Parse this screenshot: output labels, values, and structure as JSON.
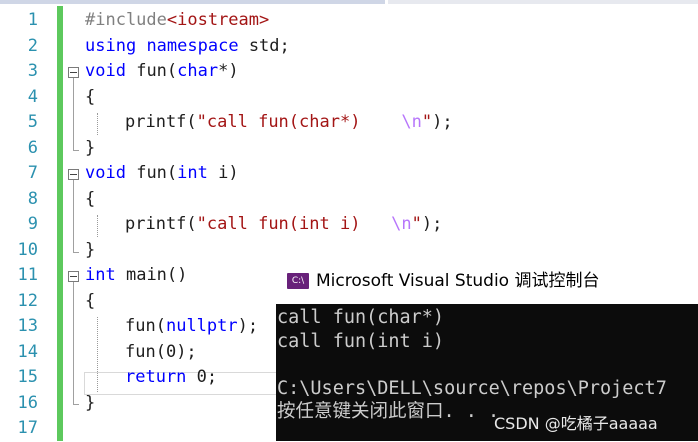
{
  "line_numbers": [
    "1",
    "2",
    "3",
    "4",
    "5",
    "6",
    "7",
    "8",
    "9",
    "10",
    "11",
    "12",
    "13",
    "14",
    "15",
    "16",
    "17"
  ],
  "code": {
    "l1": {
      "pp": "#include",
      "st": "<iostream>"
    },
    "l2": {
      "kw1": "using",
      "kw2": "namespace",
      "tx": "std;"
    },
    "l3": {
      "kw": "void",
      "fn": "fun",
      "p1": "(",
      "kw2": "char",
      "p2": "*)"
    },
    "l4": {
      "tx": "{"
    },
    "l5": {
      "fn": "printf",
      "p1": "(",
      "st1": "\"call fun(char*)    ",
      "es": "\\n",
      "st2": "\"",
      "p2": ");"
    },
    "l6": {
      "tx": "}"
    },
    "l7": {
      "kw": "void",
      "fn": "fun",
      "p1": "(",
      "kw2": "int",
      "p2": " i)"
    },
    "l8": {
      "tx": "{"
    },
    "l9": {
      "fn": "printf",
      "p1": "(",
      "st1": "\"call fun(int i)   ",
      "es": "\\n",
      "st2": "\"",
      "p2": ");"
    },
    "l10": {
      "tx": "}"
    },
    "l11": {
      "kw": "int",
      "fn": "main",
      "p": "()"
    },
    "l12": {
      "tx": "{"
    },
    "l13": {
      "fn": "fun",
      "p1": "(",
      "kw": "nullptr",
      "p2": ");"
    },
    "l14": {
      "fn": "fun",
      "p": "(0);"
    },
    "l15": {
      "kw": "return",
      "p": " 0;"
    },
    "l16": {
      "tx": "}"
    }
  },
  "console": {
    "title": "Microsoft Visual Studio 调试控制台",
    "icon_text": "C:\\",
    "lines": [
      "call fun(char*)",
      "call fun(int i)",
      "",
      "C:\\Users\\DELL\\source\\repos\\Project7",
      "按任意键关闭此窗口. . ."
    ]
  },
  "watermark": "CSDN @吃橘子aaaaa",
  "colors": {
    "keyword": "#0000ff",
    "string": "#a31515",
    "escape": "#b776fb",
    "line_number": "#2b91af",
    "change_bar": "#5dc95d",
    "console_bg": "#0c0c0c",
    "console_text": "#cccccc",
    "vs_icon": "#68217a"
  }
}
